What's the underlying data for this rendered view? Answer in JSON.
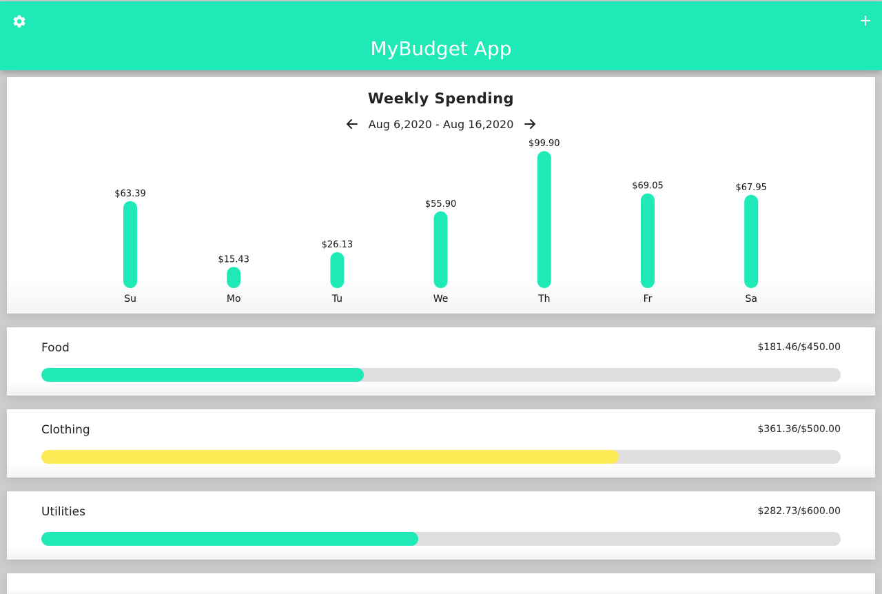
{
  "app": {
    "title": "MyBudget App"
  },
  "header": {
    "settings_icon": "gear-icon",
    "add_icon": "plus-icon"
  },
  "chart_card": {
    "title": "Weekly Spending",
    "range": "Aug 6,2020 - Aug 16,2020",
    "prev_icon": "arrow-left-icon",
    "next_icon": "arrow-right-icon"
  },
  "chart_data": {
    "type": "bar",
    "title": "Weekly Spending",
    "categories": [
      "Su",
      "Mo",
      "Tu",
      "We",
      "Th",
      "Fr",
      "Sa"
    ],
    "values": [
      63.39,
      15.43,
      26.13,
      55.9,
      99.9,
      69.05,
      67.95
    ],
    "labels": [
      "$63.39",
      "$15.43",
      "$26.13",
      "$55.90",
      "$99.90",
      "$69.05",
      "$67.95"
    ],
    "ylim": [
      0,
      100
    ],
    "grid": false,
    "color": "#1fe9b6"
  },
  "budgets": [
    {
      "category": "Food",
      "amount": "$181.46/$450.00",
      "spent": 181.46,
      "limit": 450.0,
      "color": "#1fe9b6"
    },
    {
      "category": "Clothing",
      "amount": "$361.36/$500.00",
      "spent": 361.36,
      "limit": 500.0,
      "color": "#fdeb55"
    },
    {
      "category": "Utilities",
      "amount": "$282.73/$600.00",
      "spent": 282.73,
      "limit": 600.0,
      "color": "#1fe9b6"
    }
  ],
  "colors": {
    "accent": "#1fe9b6",
    "warning": "#fdeb55",
    "track": "#dedede"
  }
}
